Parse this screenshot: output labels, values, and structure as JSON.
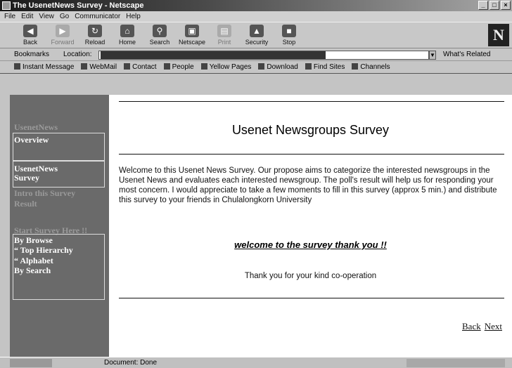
{
  "window": {
    "title": "The UsenetNews Survey - Netscape"
  },
  "menu": [
    "File",
    "Edit",
    "View",
    "Go",
    "Communicator",
    "Help"
  ],
  "toolbar": {
    "buttons": [
      {
        "label": "Back",
        "icon": "back-arrow-icon"
      },
      {
        "label": "Forward",
        "icon": "forward-arrow-icon"
      },
      {
        "label": "Reload",
        "icon": "reload-icon"
      },
      {
        "label": "Home",
        "icon": "home-icon"
      },
      {
        "label": "Search",
        "icon": "search-icon"
      },
      {
        "label": "Netscape",
        "icon": "netscape-icon"
      },
      {
        "label": "Print",
        "icon": "print-icon"
      },
      {
        "label": "Security",
        "icon": "security-lock-icon"
      },
      {
        "label": "Stop",
        "icon": "stop-icon"
      }
    ]
  },
  "location": {
    "bookmarks_label": "Bookmarks",
    "location_label": "Location:",
    "url": "",
    "related_label": "What's Related"
  },
  "personal": [
    "Instant Message",
    "WebMail",
    "Contact",
    "People",
    "Yellow Pages",
    "Download",
    "Find Sites",
    "Channels"
  ],
  "sidebar": {
    "heading": "UsenetNews",
    "overview": "Overview",
    "survey_line1": "UsenetNews",
    "survey_line2": "Survey",
    "intro": "Intro this Survey",
    "result": "Result",
    "start_heading": "Start Survey Here !!",
    "by_browse": "By Browse",
    "top_hierarchy": "Top Hierarchy",
    "alphabet": "Alphabet",
    "by_search": "By Search"
  },
  "main": {
    "title": "Usenet Newsgroups Survey",
    "intro": "Welcome to this Usenet News Survey. Our propose aims to categorize the interested newsgroups in the Usenet News and evaluates each interested newsgroup. The poll's result will help us for responding your most concern. I would appreciate to take a few moments to fill in this survey (approx 5 min.) and distribute this survey to your friends in Chulalongkorn University",
    "welcome_link": "welcome to the survey thank you !!",
    "thanks": "Thank you for your kind co-operation",
    "back_link": "Back",
    "next_link": "Next"
  },
  "status": {
    "text": "Document: Done"
  },
  "colors": {
    "sidebar": "#6a6a6a",
    "content_bg": "#ffffff",
    "chrome": "#c4c4c4"
  }
}
